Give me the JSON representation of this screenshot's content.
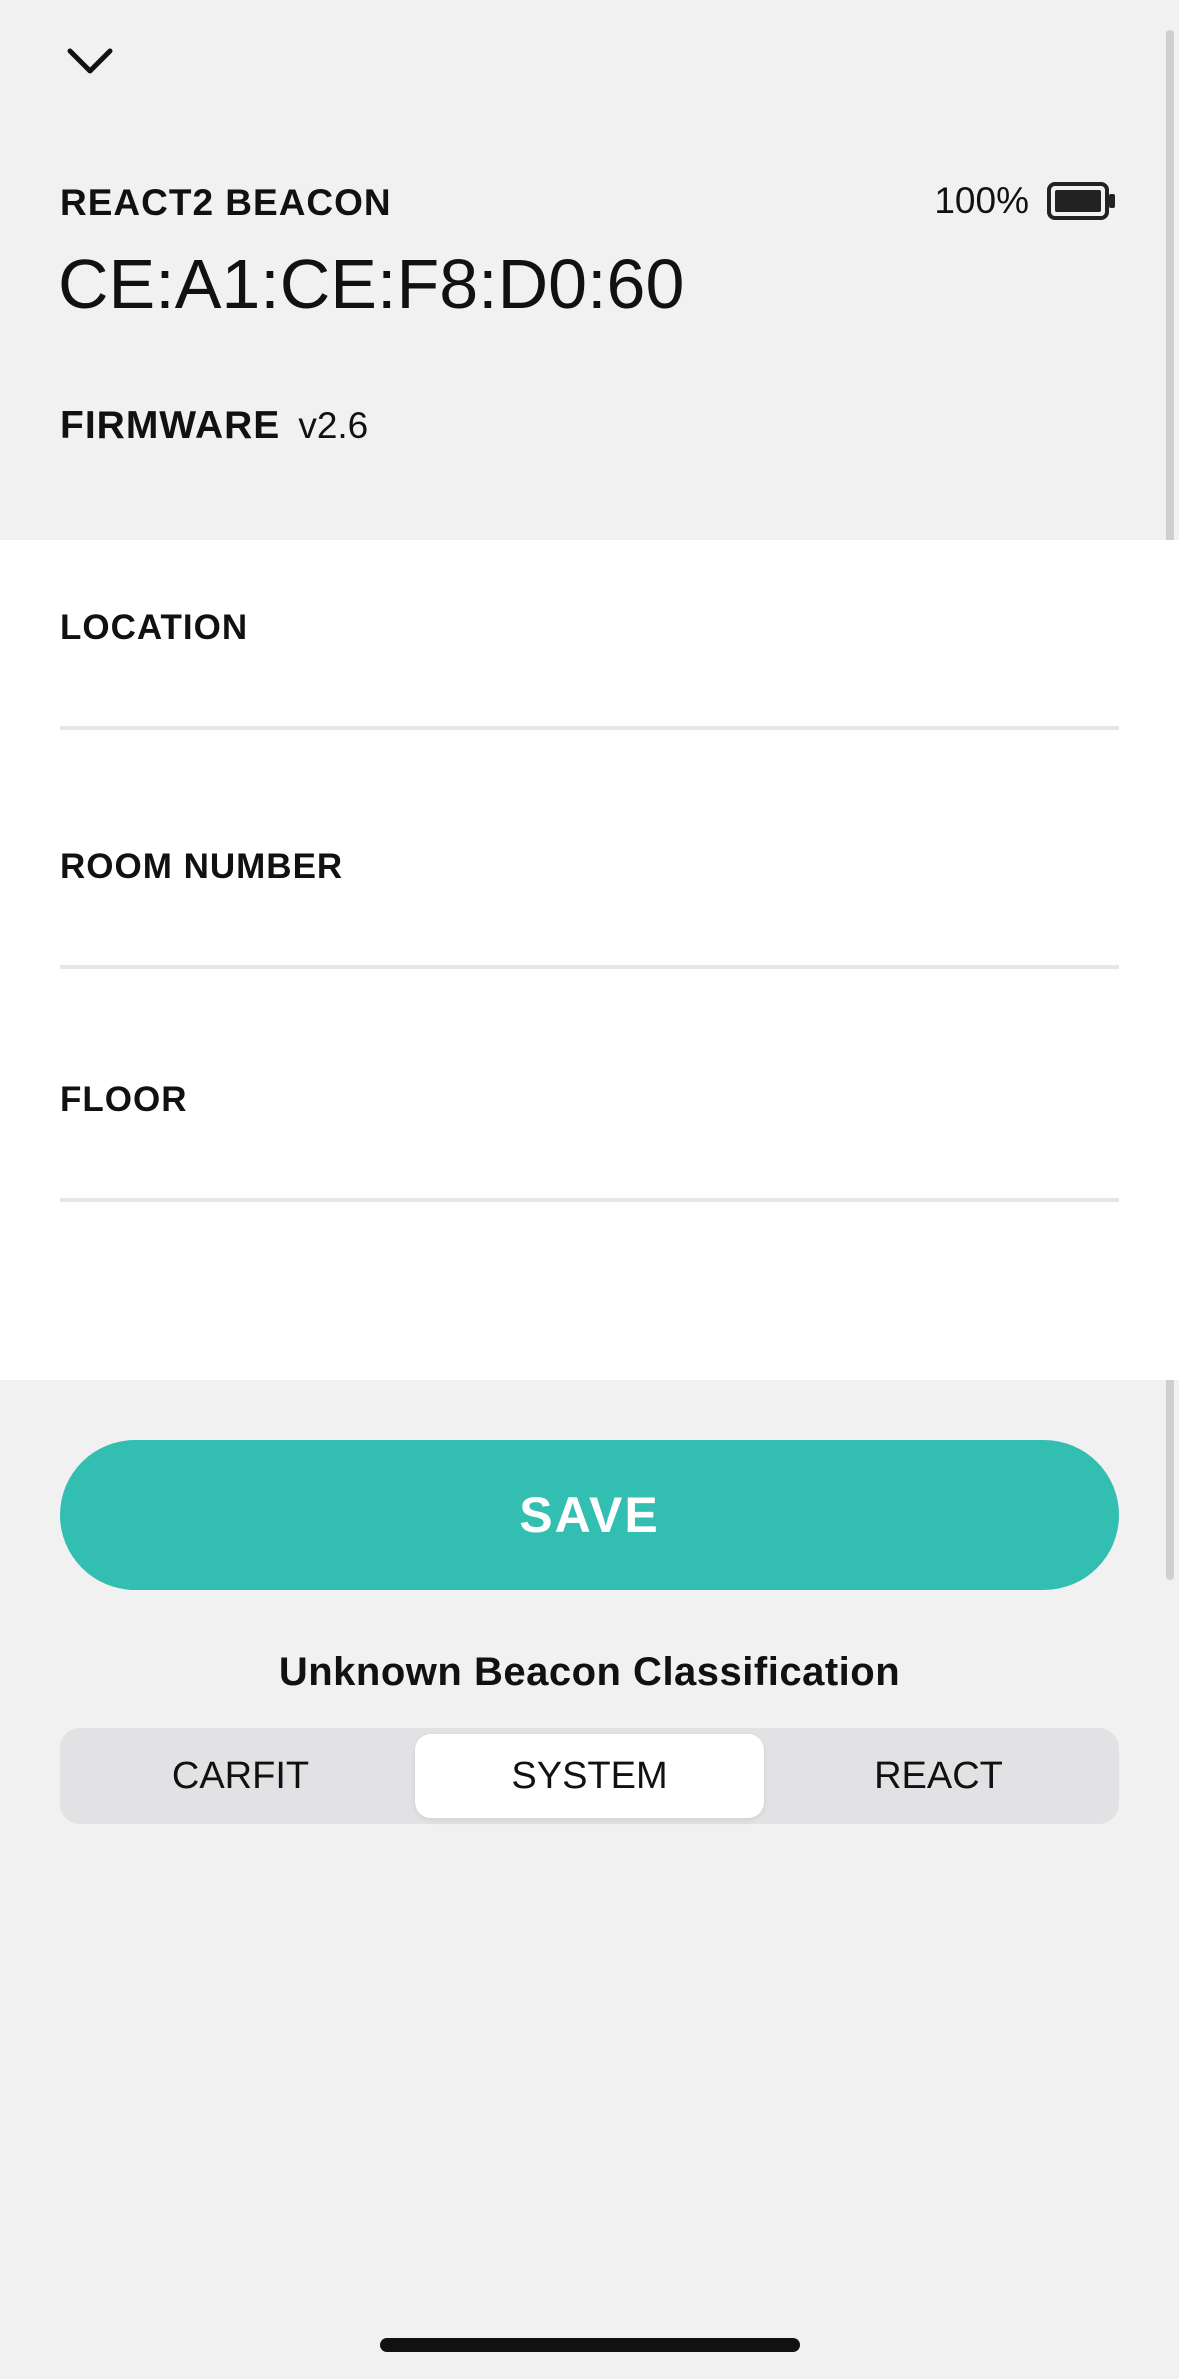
{
  "header": {
    "back_icon": "chevron-down-icon"
  },
  "device": {
    "type": "REACT2 BEACON",
    "mac_address": "CE:A1:CE:F8:D0:60",
    "battery_percent_label": "100%",
    "battery_level": 1.0,
    "battery_icon": "battery-icon",
    "firmware_label": "FIRMWARE",
    "firmware_version": "v2.6"
  },
  "form": {
    "location_label": "LOCATION",
    "location_value": "",
    "room_number_label": "ROOM NUMBER",
    "room_number_value": "",
    "floor_label": "FLOOR",
    "floor_value": ""
  },
  "save_label": "SAVE",
  "classification": {
    "title": "Unknown Beacon Classification",
    "options": [
      "CARFIT",
      "SYSTEM",
      "REACT"
    ],
    "selected": "SYSTEM"
  },
  "colors": {
    "accent": "#33beb2",
    "background": "#f1f1f1",
    "card": "#ffffff"
  }
}
